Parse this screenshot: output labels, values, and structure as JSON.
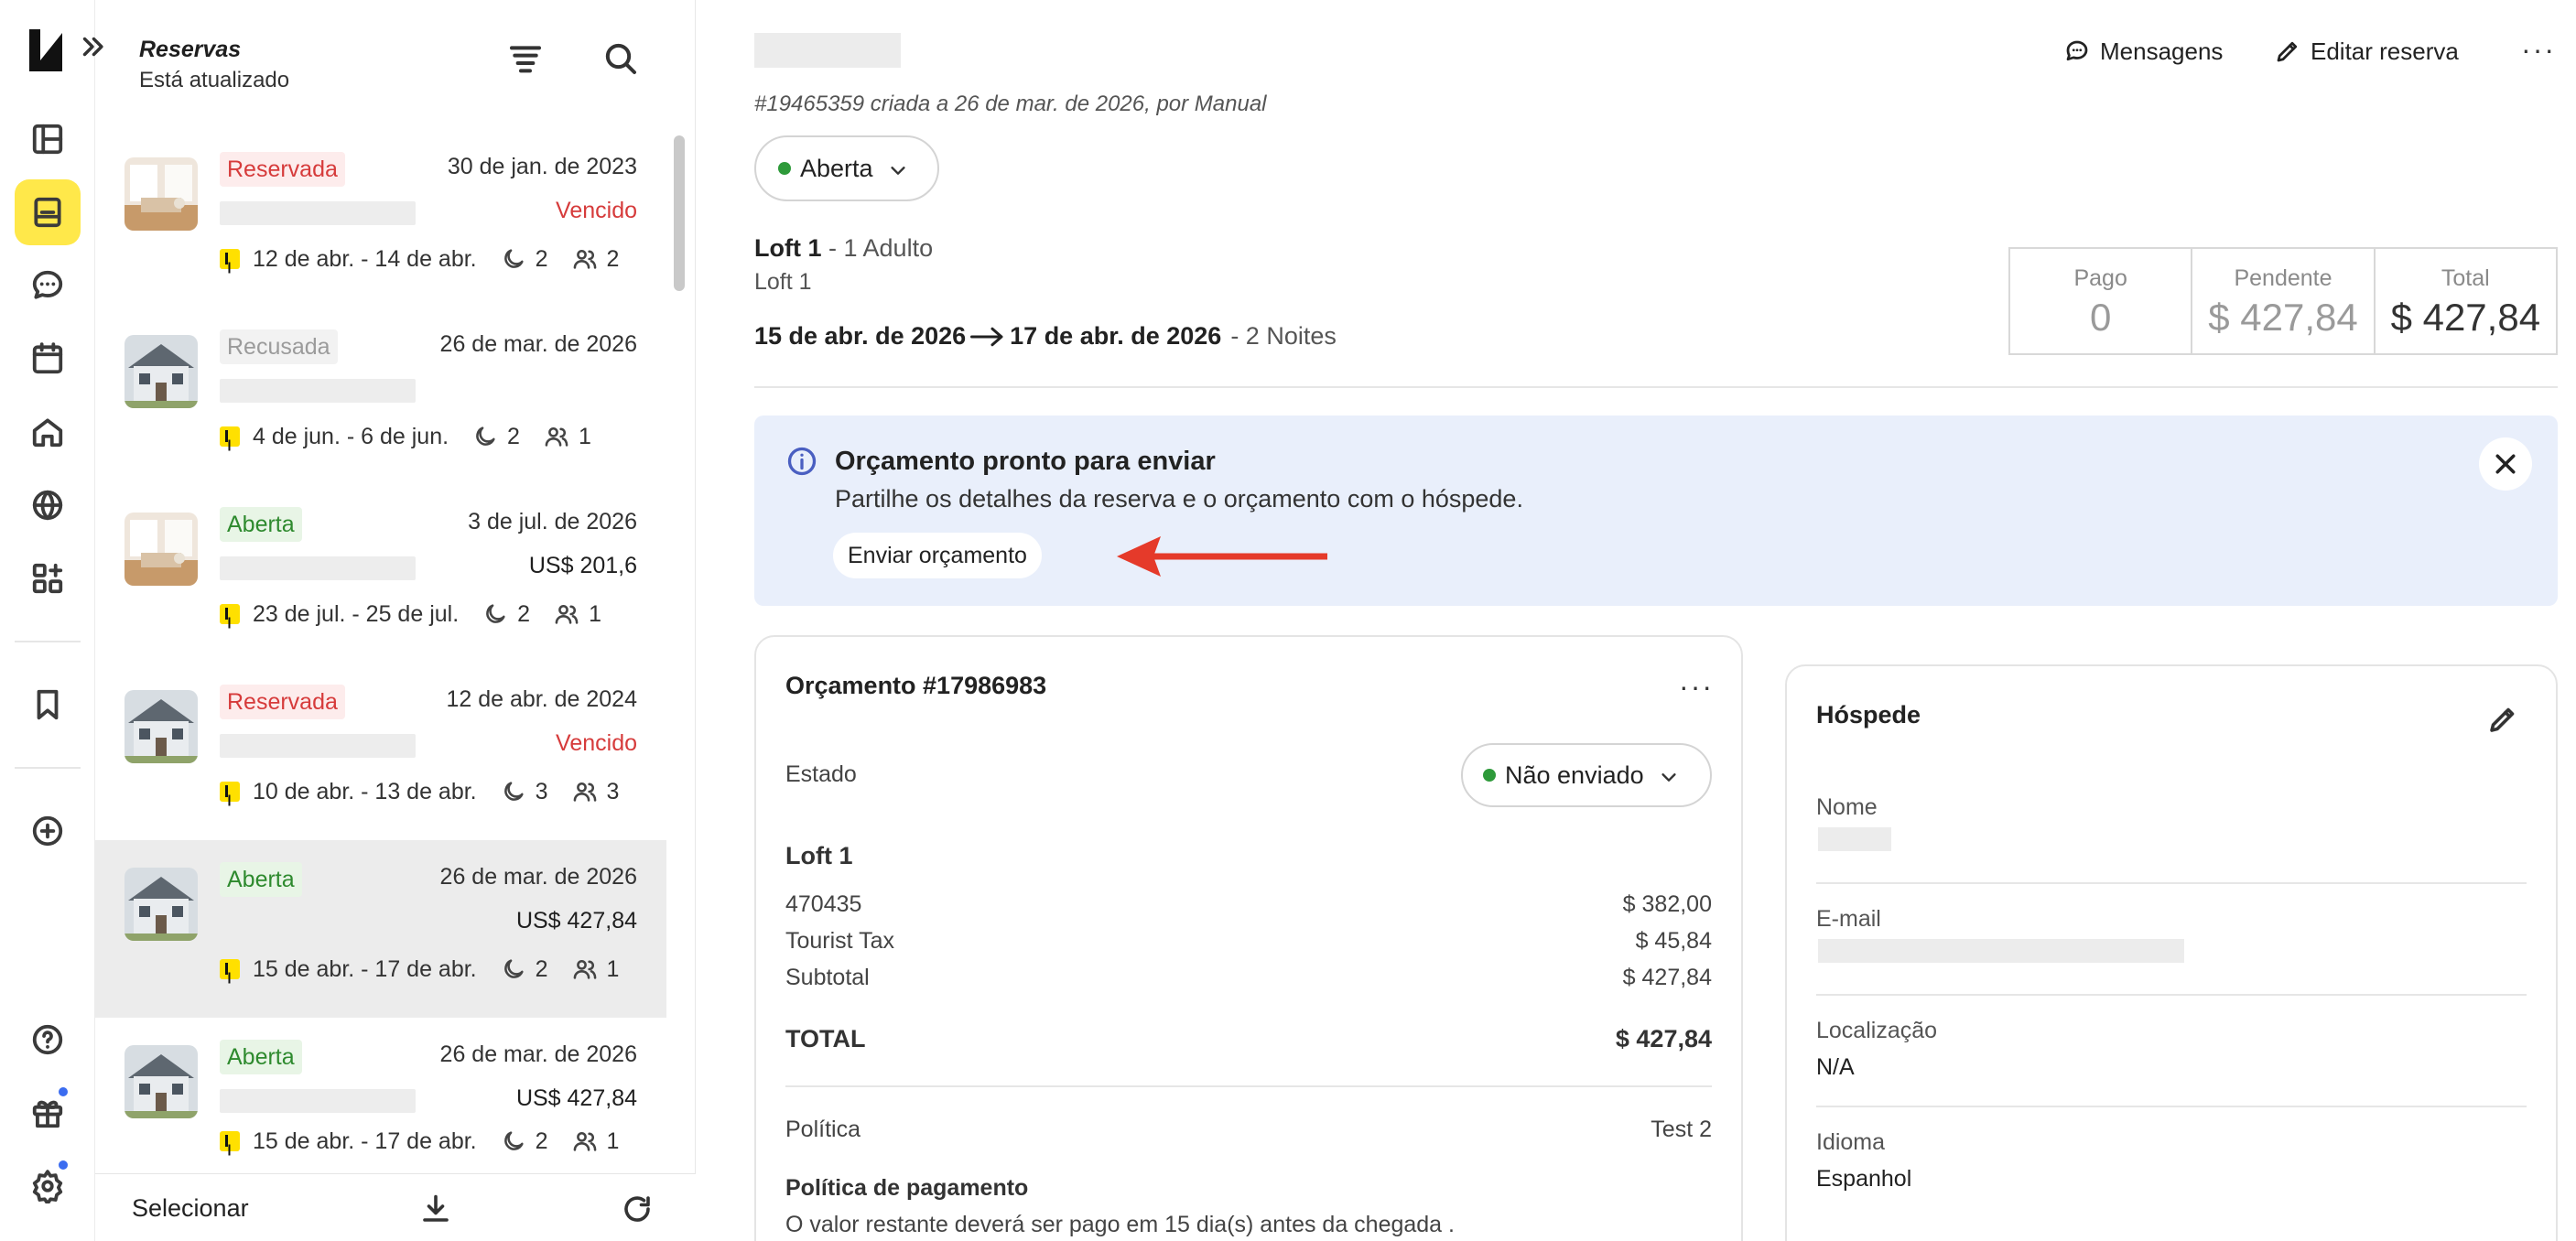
{
  "list": {
    "title": "Reservas",
    "subtitle": "Está atualizado",
    "footer_select": "Selecionar",
    "items": [
      {
        "status": "Reservada",
        "date": "30 de jan. de 2023",
        "line2": "Vencido",
        "range": "12 de abr. - 14 de abr.",
        "nights": "2",
        "guests": "2"
      },
      {
        "status": "Recusada",
        "date": "26 de mar. de 2026",
        "line2": "",
        "range": "4 de jun. - 6 de jun.",
        "nights": "2",
        "guests": "1"
      },
      {
        "status": "Aberta",
        "date": "3 de jul. de 2026",
        "line2": "US$ 201,6",
        "range": "23 de jul. - 25 de jul.",
        "nights": "2",
        "guests": "1"
      },
      {
        "status": "Reservada",
        "date": "12 de abr. de 2024",
        "line2": "Vencido",
        "range": "10 de abr. - 13 de abr.",
        "nights": "3",
        "guests": "3"
      },
      {
        "status": "Aberta",
        "date": "26 de mar. de 2026",
        "line2": "US$ 427,84",
        "range": "15 de abr. - 17 de abr.",
        "nights": "2",
        "guests": "1"
      },
      {
        "status": "Aberta",
        "date": "26 de mar. de 2026",
        "line2": "US$ 427,84",
        "range": "15 de abr. - 17 de abr.",
        "nights": "2",
        "guests": "1"
      }
    ]
  },
  "header": {
    "messages": "Mensagens",
    "edit": "Editar reserva",
    "created": "#19465359 criada a 26 de mar. de 2026, por Manual",
    "status": "Aberta"
  },
  "booking": {
    "unit": "Loft 1",
    "occupancy": "- 1 Adulto",
    "unit_sub": "Loft 1",
    "checkin": "15 de abr. de 2026",
    "checkout": "17 de abr. de 2026",
    "nights": "- 2 Noites"
  },
  "totals": {
    "paid_label": "Pago",
    "paid": "0",
    "pending_label": "Pendente",
    "pending": "$ 427,84",
    "total_label": "Total",
    "total": "$ 427,84"
  },
  "banner": {
    "title": "Orçamento pronto para enviar",
    "text": "Partilhe os detalhes da reserva e o orçamento com o hóspede.",
    "button": "Enviar orçamento"
  },
  "quote": {
    "title": "Orçamento #17986983",
    "state_label": "Estado",
    "state": "Não enviado",
    "unit": "Loft 1",
    "rows": [
      {
        "label": "470435",
        "value": "$ 382,00"
      },
      {
        "label": "Tourist Tax",
        "value": "$ 45,84"
      },
      {
        "label": "Subtotal",
        "value": "$ 427,84"
      }
    ],
    "total_label": "TOTAL",
    "total": "$ 427,84",
    "policy_label": "Política",
    "policy": "Test 2",
    "payment_policy_title": "Política de pagamento",
    "payment_policy_text": "O valor restante deverá ser pago em 15 dia(s) antes da chegada ."
  },
  "guest": {
    "title": "Hóspede",
    "name_label": "Nome",
    "email_label": "E-mail",
    "location_label": "Localização",
    "location": "N/A",
    "language_label": "Idioma",
    "language": "Espanhol"
  },
  "colors": {
    "accent": "#ffe84a",
    "reserved": "#d63b3b",
    "open": "#2e8a2e",
    "banner": "#e9effb",
    "arrow": "#e53a2a"
  }
}
